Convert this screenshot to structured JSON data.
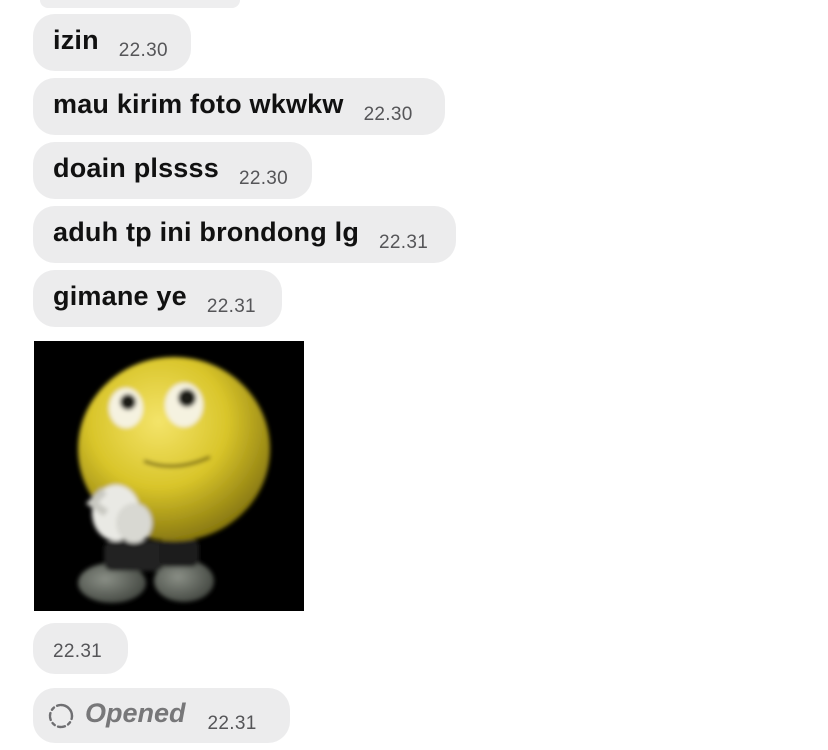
{
  "messages": [
    {
      "text": "izin",
      "time": "22.30"
    },
    {
      "text": "mau kirim foto wkwkw",
      "time": "22.30"
    },
    {
      "text": "doain plssss",
      "time": "22.30"
    },
    {
      "text": "aduh tp ini brondong lg",
      "time": "22.31"
    },
    {
      "text": "gimane ye",
      "time": "22.31"
    }
  ],
  "photo": {
    "icon": "thinking-emoji-image",
    "background": "#000000",
    "time": "22.31"
  },
  "status": {
    "icon": "opened-circle-icon",
    "label": "Opened",
    "time": "22.31"
  },
  "colors": {
    "bubble": "#ececed",
    "text": "#111111",
    "time": "#555558",
    "status": "#777779"
  }
}
